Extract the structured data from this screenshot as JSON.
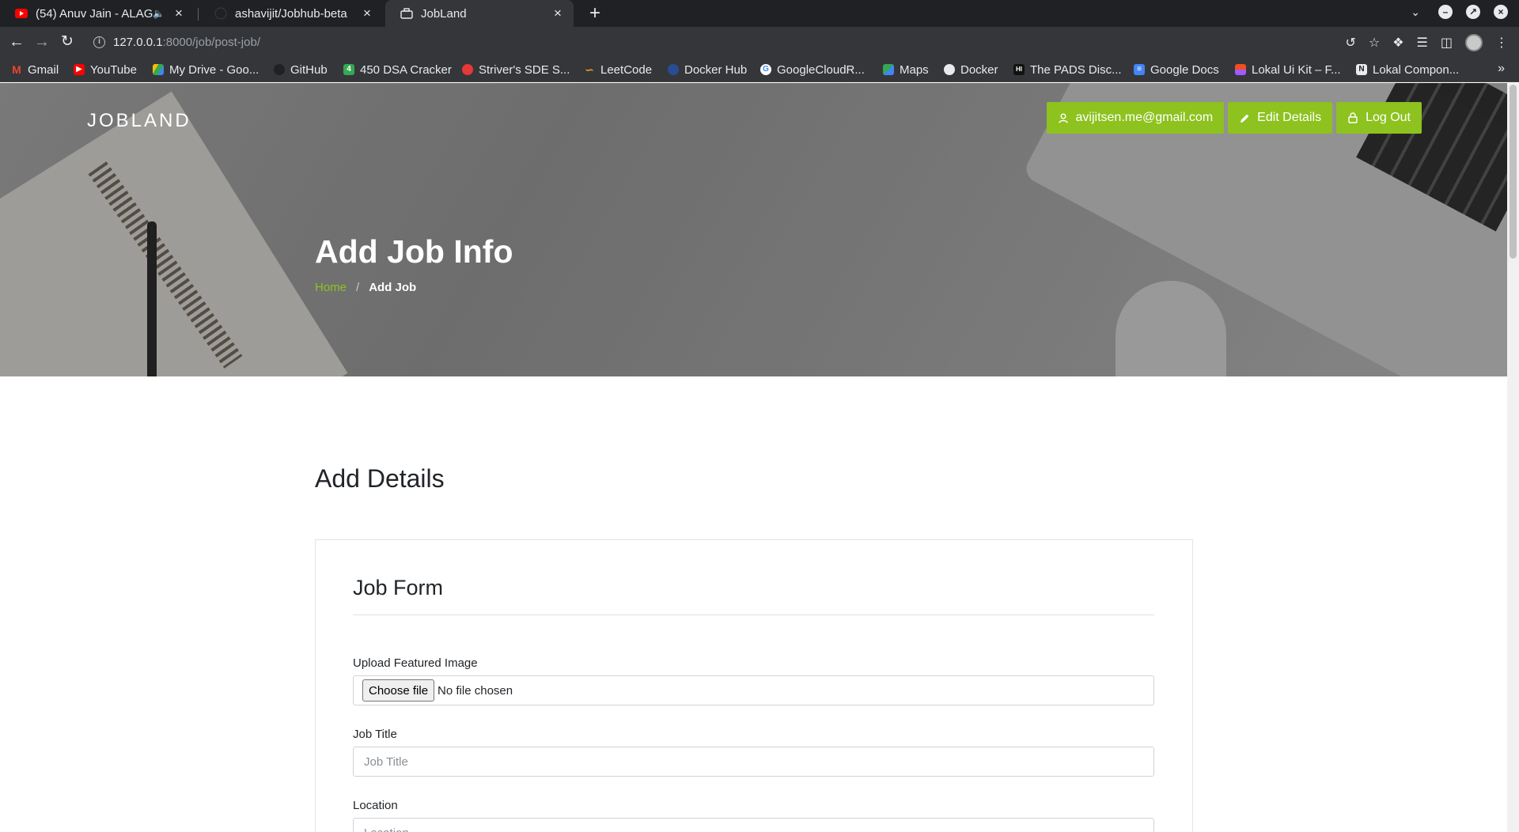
{
  "browser": {
    "tabs": [
      {
        "title": "(54) Anuv Jain - ALAG A",
        "icon": "youtube-icon"
      },
      {
        "title": "ashavijit/Jobhub-beta",
        "icon": "github-icon"
      },
      {
        "title": "JobLand",
        "icon": "briefcase-icon"
      }
    ],
    "url_host": "127.0.0.1",
    "url_path": ":8000/job/post-job/",
    "bookmarks": [
      {
        "label": "Gmail",
        "color": "#ea4335"
      },
      {
        "label": "YouTube",
        "color": "#ff0000"
      },
      {
        "label": "My Drive - Goo...",
        "color": "#fbbc04"
      },
      {
        "label": "GitHub",
        "color": "#202124"
      },
      {
        "label": "450 DSA Cracker",
        "color": "#34a853"
      },
      {
        "label": "Striver's SDE S...",
        "color": "#e53935"
      },
      {
        "label": "LeetCode",
        "color": "#f59e0b"
      },
      {
        "label": "Docker Hub",
        "color": "#1d63ed"
      },
      {
        "label": "GoogleCloudR...",
        "color": "#4285f4"
      },
      {
        "label": "Maps",
        "color": "#34a853"
      },
      {
        "label": "Docker",
        "color": "#e8eaed"
      },
      {
        "label": "The PADS Disc...",
        "color": "#111111"
      },
      {
        "label": "Google Docs",
        "color": "#4285f4"
      },
      {
        "label": "Lokal Ui Kit – F...",
        "color": "#f24e1e"
      },
      {
        "label": "Lokal Compon...",
        "color": "#e8eaed"
      }
    ]
  },
  "header": {
    "brand": "JOBLAND",
    "user_email": "avijitsen.me@gmail.com",
    "edit_label": "Edit Details",
    "logout_label": "Log Out",
    "accent": "#8dc21f"
  },
  "hero": {
    "title": "Add Job Info",
    "breadcrumb_home": "Home",
    "breadcrumb_sep": "/",
    "breadcrumb_current": "Add Job"
  },
  "main": {
    "section_title": "Add Details",
    "form_title": "Job Form",
    "image_label": "Upload Featured Image",
    "file_button": "Choose file",
    "file_status": "No file chosen",
    "job_title_label": "Job Title",
    "job_title_placeholder": "Job Title",
    "location_label": "Location",
    "location_placeholder": "Location"
  }
}
